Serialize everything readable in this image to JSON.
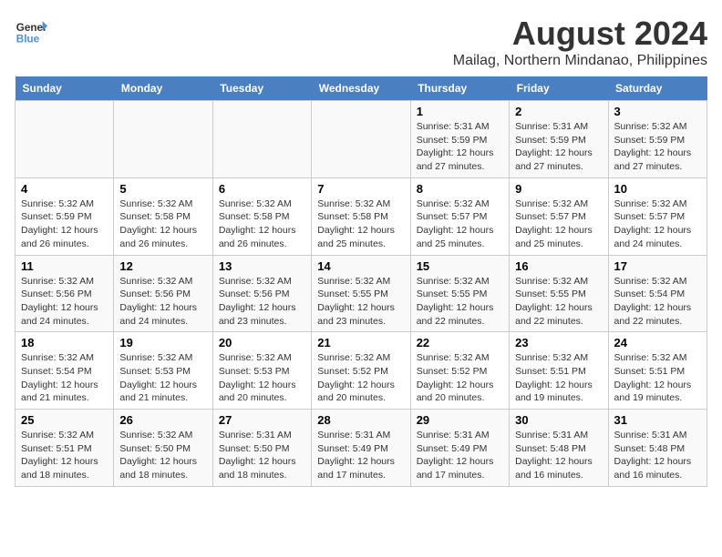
{
  "header": {
    "logo_line1": "General",
    "logo_line2": "Blue",
    "title": "August 2024",
    "subtitle": "Mailag, Northern Mindanao, Philippines"
  },
  "days_of_week": [
    "Sunday",
    "Monday",
    "Tuesday",
    "Wednesday",
    "Thursday",
    "Friday",
    "Saturday"
  ],
  "weeks": [
    [
      {
        "num": "",
        "info": ""
      },
      {
        "num": "",
        "info": ""
      },
      {
        "num": "",
        "info": ""
      },
      {
        "num": "",
        "info": ""
      },
      {
        "num": "1",
        "info": "Sunrise: 5:31 AM\nSunset: 5:59 PM\nDaylight: 12 hours\nand 27 minutes."
      },
      {
        "num": "2",
        "info": "Sunrise: 5:31 AM\nSunset: 5:59 PM\nDaylight: 12 hours\nand 27 minutes."
      },
      {
        "num": "3",
        "info": "Sunrise: 5:32 AM\nSunset: 5:59 PM\nDaylight: 12 hours\nand 27 minutes."
      }
    ],
    [
      {
        "num": "4",
        "info": "Sunrise: 5:32 AM\nSunset: 5:59 PM\nDaylight: 12 hours\nand 26 minutes."
      },
      {
        "num": "5",
        "info": "Sunrise: 5:32 AM\nSunset: 5:58 PM\nDaylight: 12 hours\nand 26 minutes."
      },
      {
        "num": "6",
        "info": "Sunrise: 5:32 AM\nSunset: 5:58 PM\nDaylight: 12 hours\nand 26 minutes."
      },
      {
        "num": "7",
        "info": "Sunrise: 5:32 AM\nSunset: 5:58 PM\nDaylight: 12 hours\nand 25 minutes."
      },
      {
        "num": "8",
        "info": "Sunrise: 5:32 AM\nSunset: 5:57 PM\nDaylight: 12 hours\nand 25 minutes."
      },
      {
        "num": "9",
        "info": "Sunrise: 5:32 AM\nSunset: 5:57 PM\nDaylight: 12 hours\nand 25 minutes."
      },
      {
        "num": "10",
        "info": "Sunrise: 5:32 AM\nSunset: 5:57 PM\nDaylight: 12 hours\nand 24 minutes."
      }
    ],
    [
      {
        "num": "11",
        "info": "Sunrise: 5:32 AM\nSunset: 5:56 PM\nDaylight: 12 hours\nand 24 minutes."
      },
      {
        "num": "12",
        "info": "Sunrise: 5:32 AM\nSunset: 5:56 PM\nDaylight: 12 hours\nand 24 minutes."
      },
      {
        "num": "13",
        "info": "Sunrise: 5:32 AM\nSunset: 5:56 PM\nDaylight: 12 hours\nand 23 minutes."
      },
      {
        "num": "14",
        "info": "Sunrise: 5:32 AM\nSunset: 5:55 PM\nDaylight: 12 hours\nand 23 minutes."
      },
      {
        "num": "15",
        "info": "Sunrise: 5:32 AM\nSunset: 5:55 PM\nDaylight: 12 hours\nand 22 minutes."
      },
      {
        "num": "16",
        "info": "Sunrise: 5:32 AM\nSunset: 5:55 PM\nDaylight: 12 hours\nand 22 minutes."
      },
      {
        "num": "17",
        "info": "Sunrise: 5:32 AM\nSunset: 5:54 PM\nDaylight: 12 hours\nand 22 minutes."
      }
    ],
    [
      {
        "num": "18",
        "info": "Sunrise: 5:32 AM\nSunset: 5:54 PM\nDaylight: 12 hours\nand 21 minutes."
      },
      {
        "num": "19",
        "info": "Sunrise: 5:32 AM\nSunset: 5:53 PM\nDaylight: 12 hours\nand 21 minutes."
      },
      {
        "num": "20",
        "info": "Sunrise: 5:32 AM\nSunset: 5:53 PM\nDaylight: 12 hours\nand 20 minutes."
      },
      {
        "num": "21",
        "info": "Sunrise: 5:32 AM\nSunset: 5:52 PM\nDaylight: 12 hours\nand 20 minutes."
      },
      {
        "num": "22",
        "info": "Sunrise: 5:32 AM\nSunset: 5:52 PM\nDaylight: 12 hours\nand 20 minutes."
      },
      {
        "num": "23",
        "info": "Sunrise: 5:32 AM\nSunset: 5:51 PM\nDaylight: 12 hours\nand 19 minutes."
      },
      {
        "num": "24",
        "info": "Sunrise: 5:32 AM\nSunset: 5:51 PM\nDaylight: 12 hours\nand 19 minutes."
      }
    ],
    [
      {
        "num": "25",
        "info": "Sunrise: 5:32 AM\nSunset: 5:51 PM\nDaylight: 12 hours\nand 18 minutes."
      },
      {
        "num": "26",
        "info": "Sunrise: 5:32 AM\nSunset: 5:50 PM\nDaylight: 12 hours\nand 18 minutes."
      },
      {
        "num": "27",
        "info": "Sunrise: 5:31 AM\nSunset: 5:50 PM\nDaylight: 12 hours\nand 18 minutes."
      },
      {
        "num": "28",
        "info": "Sunrise: 5:31 AM\nSunset: 5:49 PM\nDaylight: 12 hours\nand 17 minutes."
      },
      {
        "num": "29",
        "info": "Sunrise: 5:31 AM\nSunset: 5:49 PM\nDaylight: 12 hours\nand 17 minutes."
      },
      {
        "num": "30",
        "info": "Sunrise: 5:31 AM\nSunset: 5:48 PM\nDaylight: 12 hours\nand 16 minutes."
      },
      {
        "num": "31",
        "info": "Sunrise: 5:31 AM\nSunset: 5:48 PM\nDaylight: 12 hours\nand 16 minutes."
      }
    ]
  ]
}
